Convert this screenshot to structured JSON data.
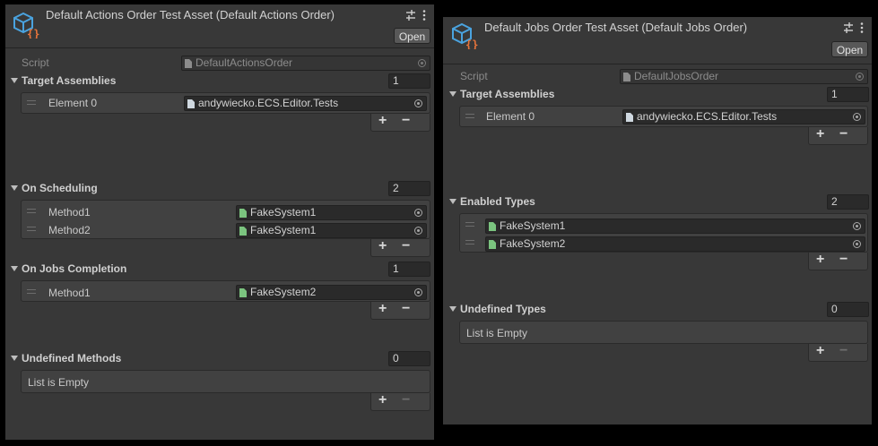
{
  "left": {
    "title": "Default Actions Order Test Asset (Default Actions Order)",
    "open_label": "Open",
    "script_label": "Script",
    "script_value": "DefaultActionsOrder",
    "target_assemblies": {
      "label": "Target Assemblies",
      "count": "1",
      "items": [
        {
          "label": "Element 0",
          "value": "andywiecko.ECS.Editor.Tests"
        }
      ]
    },
    "on_scheduling": {
      "label": "On Scheduling",
      "count": "2",
      "items": [
        {
          "label": "Method1",
          "value": "FakeSystem1"
        },
        {
          "label": "Method2",
          "value": "FakeSystem1"
        }
      ]
    },
    "on_jobs_completion": {
      "label": "On Jobs Completion",
      "count": "1",
      "items": [
        {
          "label": "Method1",
          "value": "FakeSystem2"
        }
      ]
    },
    "undefined_methods": {
      "label": "Undefined Methods",
      "count": "0",
      "empty_text": "List is Empty"
    },
    "plus": "+",
    "minus": "−"
  },
  "right": {
    "title": "Default Jobs Order Test Asset (Default Jobs Order)",
    "open_label": "Open",
    "script_label": "Script",
    "script_value": "DefaultJobsOrder",
    "target_assemblies": {
      "label": "Target Assemblies",
      "count": "1",
      "items": [
        {
          "label": "Element 0",
          "value": "andywiecko.ECS.Editor.Tests"
        }
      ]
    },
    "enabled_types": {
      "label": "Enabled Types",
      "count": "2",
      "items": [
        {
          "value": "FakeSystem1"
        },
        {
          "value": "FakeSystem2"
        }
      ]
    },
    "undefined_types": {
      "label": "Undefined Types",
      "count": "0",
      "empty_text": "List is Empty"
    },
    "plus": "+",
    "minus": "−"
  },
  "colors": {
    "panel": "#383838",
    "field": "#2a2a2a",
    "list": "#414141",
    "icon_blue": "#4aa3df",
    "icon_orange": "#e8743b",
    "script_green": "#7bc47f"
  }
}
